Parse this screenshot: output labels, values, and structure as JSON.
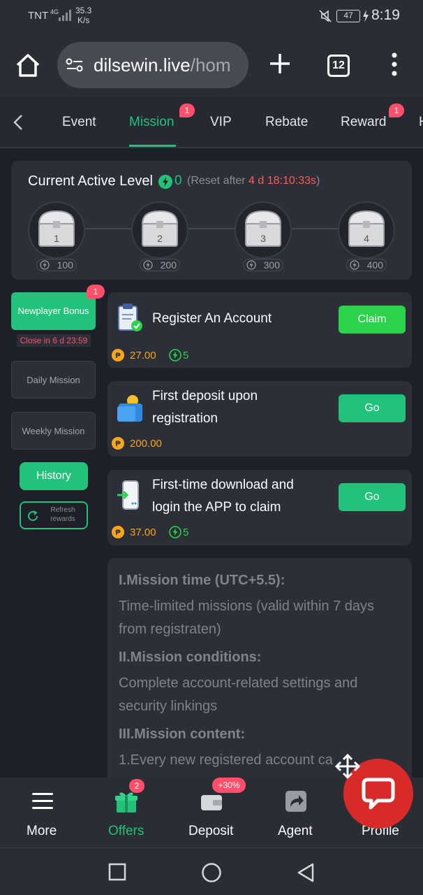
{
  "status_bar": {
    "carrier": "TNT",
    "network": "4G",
    "speed_value": "35.3",
    "speed_unit": "K/s",
    "battery": "47",
    "time": "8:19"
  },
  "browser": {
    "url_host": "dilsewin.live",
    "url_path": "/hom",
    "tab_count": "12"
  },
  "tabs": [
    {
      "label": "Event",
      "active": false
    },
    {
      "label": "Mission",
      "active": true,
      "badge": "1"
    },
    {
      "label": "VIP",
      "active": false
    },
    {
      "label": "Rebate",
      "active": false
    },
    {
      "label": "Reward",
      "active": false,
      "badge": "1"
    },
    {
      "label": "H",
      "active": false
    }
  ],
  "level": {
    "title": "Current Active Level",
    "value": "0",
    "reset_prefix": "(Reset after ",
    "reset_countdown": "4 d 18:10:33s",
    "reset_suffix": ")",
    "chests": [
      {
        "number": "1",
        "amount": "100"
      },
      {
        "number": "2",
        "amount": "200"
      },
      {
        "number": "3",
        "amount": "300"
      },
      {
        "number": "4",
        "amount": "400"
      }
    ]
  },
  "sidebar": {
    "newplayer_label": "Newplayer Bonus",
    "newplayer_badge": "1",
    "close_in": "Close in 6 d 23:59",
    "daily_label": "Daily Mission",
    "weekly_label": "Weekly Mission",
    "history_label": "History",
    "refresh_label": "Refresh rewards"
  },
  "missions": [
    {
      "title": "Register An Account",
      "button": "Claim",
      "coins": "27.00",
      "bolts": "5"
    },
    {
      "title_line1": "First deposit upon",
      "title_line2": "registration",
      "button": "Go",
      "coins": "200.00"
    },
    {
      "title_line1": "First-time download and",
      "title_line2": "login the APP to claim",
      "button": "Go",
      "coins": "37.00",
      "bolts": "5"
    }
  ],
  "rules": {
    "h1": "I.Mission time (UTC+5.5):",
    "p1_line1": "Time-limited missions (valid within 7 days",
    "p1_line2": "from registraten)",
    "h2": "II.Mission conditions:",
    "p2_line1": "Complete account-related settings and",
    "p2_line2": "security linkings",
    "h3": "III.Mission content:",
    "p3_line1": "1.Every new registered account ca"
  },
  "bottom_nav": {
    "more": "More",
    "offers": "Offers",
    "offers_badge": "2",
    "deposit": "Deposit",
    "deposit_badge": "+30%",
    "agent": "Agent",
    "profile": "Profile"
  },
  "colors": {
    "accent": "#22c27a",
    "badge": "#ff4f6b",
    "countdown": "#ff5a5a",
    "coin": "#f6a51d",
    "background": "#1e2029",
    "card": "#2c2e38",
    "chat": "#d92a2a"
  }
}
